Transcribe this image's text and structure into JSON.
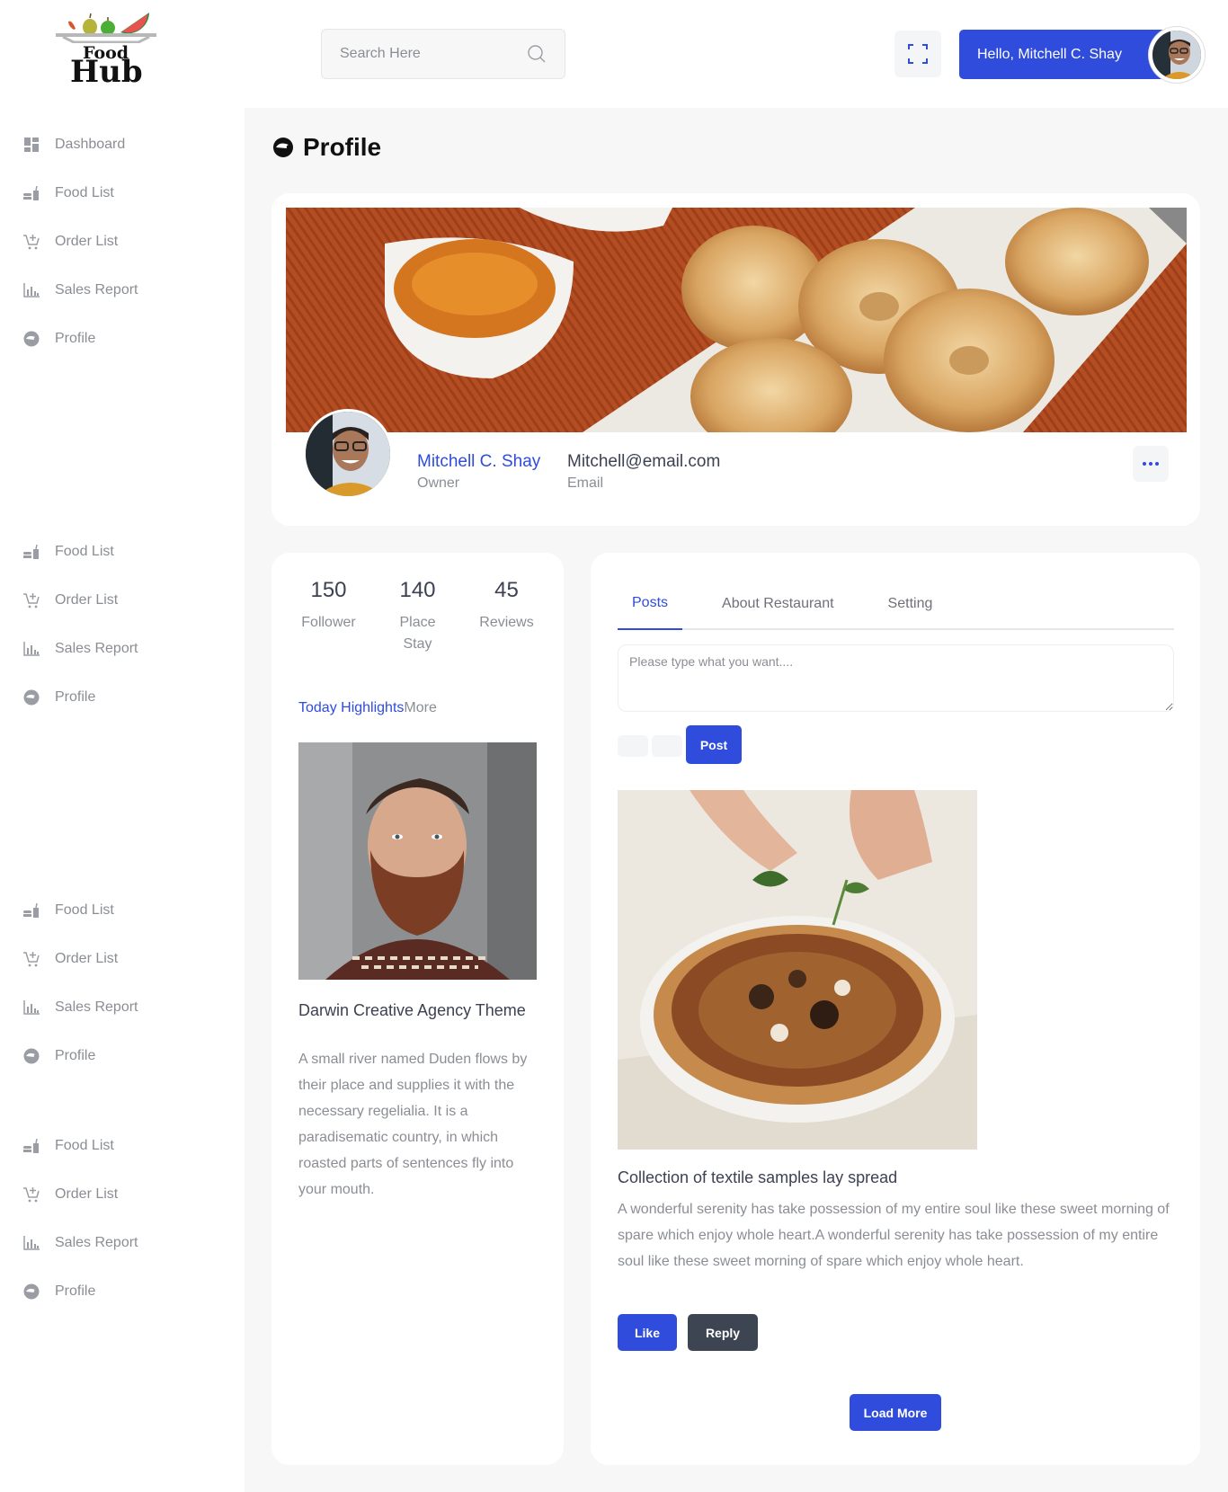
{
  "brand": {
    "line1": "Food",
    "line2": "Hub"
  },
  "sidebar": {
    "groups": [
      {
        "items": [
          {
            "label": "Dashboard",
            "icon": "dashboard-icon"
          },
          {
            "label": "Food List",
            "icon": "food-icon"
          },
          {
            "label": "Order List",
            "icon": "cart-icon"
          },
          {
            "label": "Sales Report",
            "icon": "chart-icon"
          },
          {
            "label": "Profile",
            "icon": "face-icon"
          }
        ]
      },
      {
        "items": [
          {
            "label": "Food List",
            "icon": "food-icon"
          },
          {
            "label": "Order List",
            "icon": "cart-icon"
          },
          {
            "label": "Sales Report",
            "icon": "chart-icon"
          },
          {
            "label": "Profile",
            "icon": "face-icon"
          }
        ]
      },
      {
        "items": [
          {
            "label": "Food List",
            "icon": "food-icon"
          },
          {
            "label": "Order List",
            "icon": "cart-icon"
          },
          {
            "label": "Sales Report",
            "icon": "chart-icon"
          },
          {
            "label": "Profile",
            "icon": "face-icon"
          }
        ]
      },
      {
        "items": [
          {
            "label": "Food List",
            "icon": "food-icon"
          },
          {
            "label": "Order List",
            "icon": "cart-icon"
          },
          {
            "label": "Sales Report",
            "icon": "chart-icon"
          },
          {
            "label": "Profile",
            "icon": "face-icon"
          }
        ]
      }
    ]
  },
  "header": {
    "search_placeholder": "Search Here",
    "greeting": "Hello, Mitchell C. Shay"
  },
  "page": {
    "title": "Profile"
  },
  "profile": {
    "name": "Mitchell C. Shay",
    "role": "Owner",
    "email": "Mitchell@email.com",
    "email_label": "Email"
  },
  "stats": [
    {
      "value": "150",
      "label": "Follower"
    },
    {
      "value": "140",
      "label": "Place Stay"
    },
    {
      "value": "45",
      "label": "Reviews"
    }
  ],
  "highlights": {
    "title": "Today Highlights",
    "more": "More",
    "item_title": "Darwin Creative Agency Theme",
    "item_text": "A small river named Duden flows by their place and supplies it with the necessary regelialia. It is a paradisematic country, in which roasted parts of sentences fly into your mouth."
  },
  "tabs": [
    {
      "label": "Posts",
      "active": true
    },
    {
      "label": "About Restaurant",
      "active": false
    },
    {
      "label": "Setting",
      "active": false
    }
  ],
  "composer": {
    "placeholder": "Please type what you want....",
    "post_label": "Post"
  },
  "post": {
    "title": "Collection of textile samples lay spread",
    "text": "A wonderful serenity has take possession of my entire soul like these sweet morning of spare which enjoy whole heart.A wonderful serenity has take possession of my entire soul like these sweet morning of spare which enjoy whole heart.",
    "like_label": "Like",
    "reply_label": "Reply"
  },
  "load_more_label": "Load More",
  "colors": {
    "accent": "#2f4cdd",
    "dark_button": "#3d4452",
    "muted_text": "#8a8e94"
  }
}
